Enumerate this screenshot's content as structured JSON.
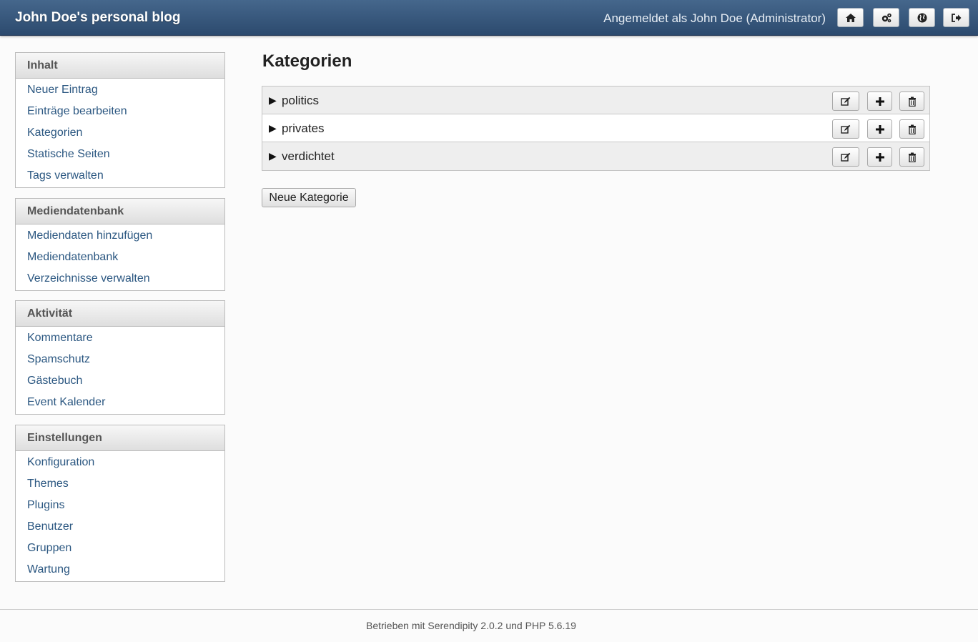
{
  "header": {
    "blog_title": "John Doe's personal blog",
    "login_info": "Angemeldet als John Doe (Administrator)",
    "buttons": [
      {
        "name": "home",
        "icon": "home-icon"
      },
      {
        "name": "settings",
        "icon": "gears-icon"
      },
      {
        "name": "blog",
        "icon": "globe-icon"
      },
      {
        "name": "logout",
        "icon": "logout-icon"
      }
    ]
  },
  "sidebar": {
    "content": {
      "title": "Inhalt",
      "items": [
        "Neuer Eintrag",
        "Einträge bearbeiten",
        "Kategorien",
        "Statische Seiten",
        "Tags verwalten"
      ]
    },
    "media": {
      "title": "Mediendatenbank",
      "items": [
        "Mediendaten hinzufügen",
        "Mediendatenbank",
        "Verzeichnisse verwalten"
      ]
    },
    "activity": {
      "title": "Aktivität",
      "items": [
        "Kommentare",
        "Spamschutz",
        "Gästebuch",
        "Event Kalender"
      ]
    },
    "settings": {
      "title": "Einstellungen",
      "items": [
        "Konfiguration",
        "Themes",
        "Plugins",
        "Benutzer",
        "Gruppen",
        "Wartung"
      ]
    }
  },
  "main": {
    "title": "Kategorien",
    "categories": [
      {
        "toggle": "▶",
        "name": "politics"
      },
      {
        "toggle": "▶",
        "name": "privates"
      },
      {
        "toggle": "▶",
        "name": "verdichtet"
      }
    ],
    "new_category_label": "Neue Kategorie"
  },
  "footer": {
    "text": "Betrieben mit Serendipity 2.0.2 und PHP 5.6.19"
  },
  "colors": {
    "header_bg": "#2c4a6e",
    "link": "#2b5781",
    "row_alt": "#eeeeee"
  }
}
